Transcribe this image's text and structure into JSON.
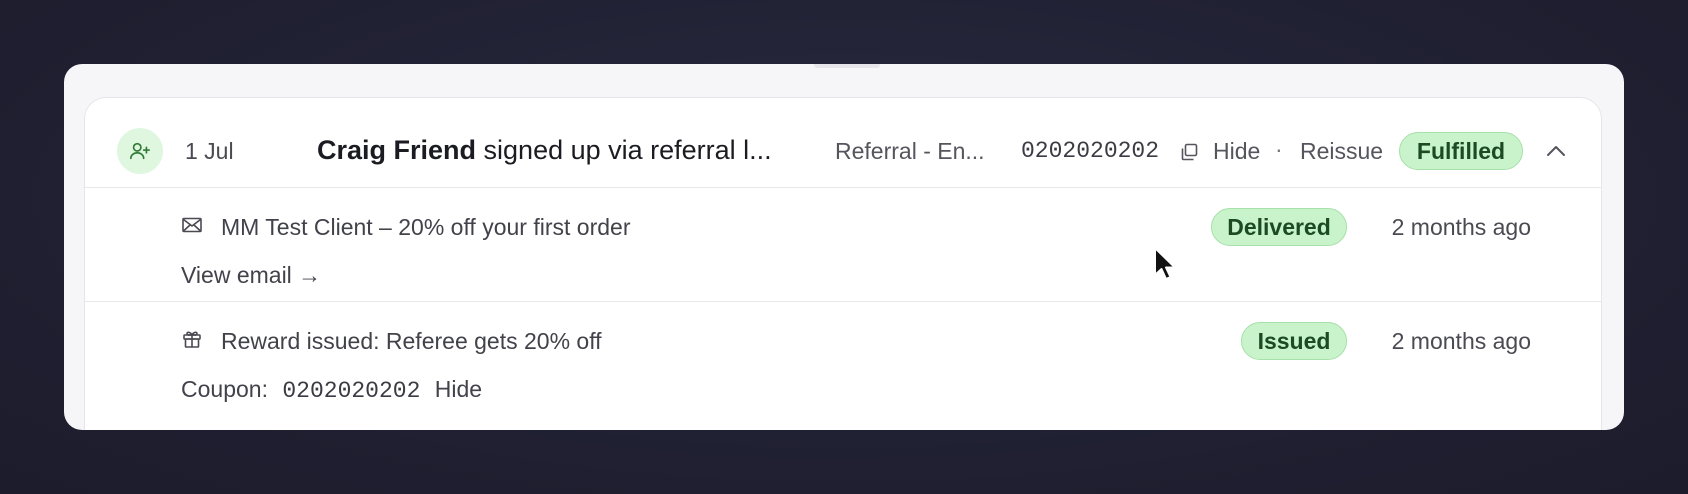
{
  "row": {
    "date": "1 Jul",
    "title_name": "Craig Friend",
    "title_rest": " signed up via referral l...",
    "campaign": "Referral - En...",
    "code": "0202020202",
    "hide_label": "Hide",
    "separator": "·",
    "reissue_label": "Reissue",
    "status": "Fulfilled"
  },
  "events": [
    {
      "icon": "mail-icon",
      "text": "MM Test Client – 20% off your first order",
      "status": "Delivered",
      "time": "2 months ago",
      "link_label": "View email →"
    },
    {
      "icon": "gift-icon",
      "text": "Reward issued: Referee gets 20% off",
      "status": "Issued",
      "time": "2 months ago",
      "coupon_label": "Coupon:",
      "coupon_code": "0202020202",
      "hide_label": "Hide"
    }
  ],
  "colors": {
    "badge_bg": "#c9f3cb",
    "badge_text": "#1c4a22",
    "avatar_bg": "#dff6df"
  }
}
